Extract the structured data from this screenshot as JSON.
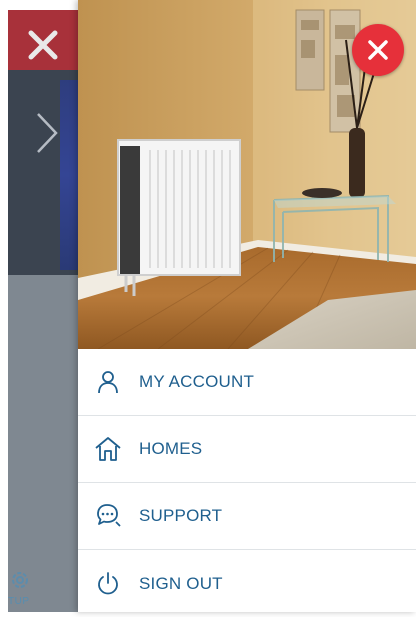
{
  "underlay": {
    "settings_label": "TUP"
  },
  "drawer": {
    "hero_alt": "Heater in living room",
    "menu": [
      {
        "id": "my-account",
        "label": "MY ACCOUNT",
        "icon": "user-icon"
      },
      {
        "id": "homes",
        "label": "HOMES",
        "icon": "home-icon"
      },
      {
        "id": "support",
        "label": "SUPPORT",
        "icon": "chat-support-icon"
      },
      {
        "id": "sign-out",
        "label": "SIGN OUT",
        "icon": "power-icon"
      }
    ]
  },
  "colors": {
    "accent_blue": "#1f5f8e",
    "close_red": "#e6303a",
    "underlay_close_red": "#a8313a"
  }
}
